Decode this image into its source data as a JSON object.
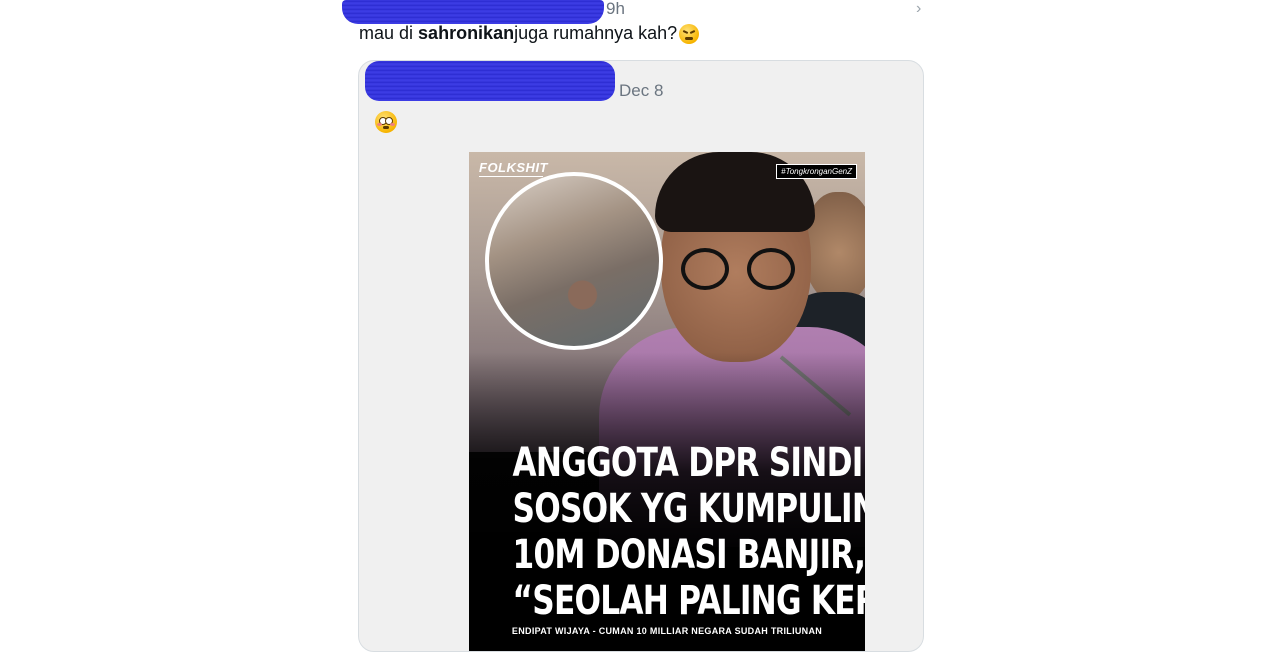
{
  "reply": {
    "time": "9h",
    "text_before": "mau di ",
    "text_bold": "sahronikan",
    "text_after": " juga rumahnya kah?",
    "emoji": "persevering-face-emoji",
    "more_icon": "chevron-right-icon"
  },
  "quoted_post": {
    "date": "Dec 8",
    "emoji": "flushed-face-emoji",
    "image": {
      "brand": "FOLKSHIT",
      "hashtag": "#TongkronganGenZ",
      "headline": [
        "ANGGOTA DPR SINDIR",
        "SOSOK YG KUMPULIN",
        "10M DONASI BANJIR,",
        "“SEOLAH PALING KERJA”"
      ],
      "subcaption": "ENDIPAT WIJAYA - CUMAN 10 MILLIAR NEGARA SUDAH TRILIUNAN"
    }
  },
  "colors": {
    "redaction": "#3a3ae0",
    "meta_text": "#6b7580",
    "quote_bg": "#f0f0f0"
  }
}
